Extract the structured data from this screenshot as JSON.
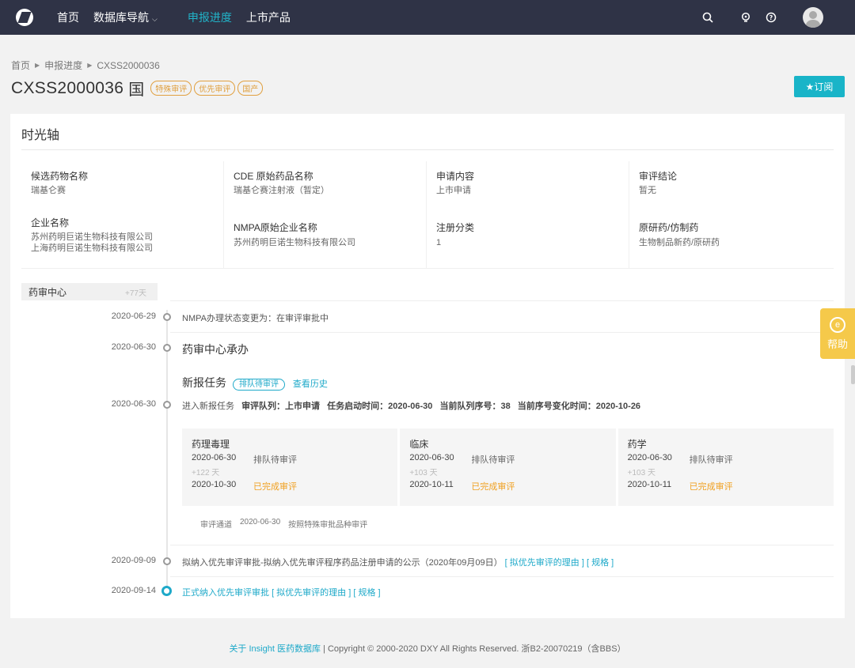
{
  "nav": {
    "items": [
      {
        "label": "首页"
      },
      {
        "label": "数据库导航"
      },
      {
        "label": "申报进度"
      },
      {
        "label": "上市产品"
      }
    ]
  },
  "breadcrumb": {
    "home": "首页",
    "section": "申报进度",
    "current": "CXSS2000036"
  },
  "header": {
    "title": "CXSS2000036",
    "title_suffix": "国",
    "tags": [
      "特殊审评",
      "优先审评",
      "国产"
    ],
    "subscribe_label": "★订阅"
  },
  "card": {
    "title": "时光轴"
  },
  "info": {
    "candidate_label": "候选药物名称",
    "candidate_value": "瑞基仑赛",
    "cde_label": "CDE 原始药品名称",
    "cde_value": "瑞基仑赛注射液（暂定）",
    "apply_label": "申请内容",
    "apply_value": "上市申请",
    "conclusion_label": "审评结论",
    "conclusion_value": "暂无",
    "company_label": "企业名称",
    "company_value_1": "苏州药明巨诺生物科技有限公司",
    "company_value_2": "上海药明巨诺生物科技有限公司",
    "nmpa_label": "NMPA原始企业名称",
    "nmpa_value": "苏州药明巨诺生物科技有限公司",
    "reg_label": "注册分类",
    "reg_value": "1",
    "orig_label": "原研药/仿制药",
    "orig_value": "生物制品新药/原研药"
  },
  "timeline": {
    "center_label": "药审中心",
    "center_days": "+77天",
    "events": [
      {
        "date": "2020-06-29",
        "text": "NMPA办理状态变更为：在审评审批中"
      },
      {
        "date": "2020-06-30",
        "text": "药审中心承办"
      },
      {
        "date": "2020-06-30",
        "text": "进入新报任务"
      }
    ],
    "task_title": "新报任务",
    "task_badge": "排队待审评",
    "task_history": "查看历史",
    "queue_info": "审评队列：上市申请",
    "start_info": "任务启动时间：2020-06-30",
    "seq_info": "当前队列序号：38",
    "seq_change_info": "当前序号变化时间：2020-10-26",
    "reviews": [
      {
        "name": "药理毒理",
        "date1": "2020-06-30",
        "status1": "排队待审评",
        "days": "+122 天",
        "date2": "2020-10-30",
        "status2": "已完成审评"
      },
      {
        "name": "临床",
        "date1": "2020-06-30",
        "status1": "排队待审评",
        "days": "+103 天",
        "date2": "2020-10-11",
        "status2": "已完成审评"
      },
      {
        "name": "药学",
        "date1": "2020-06-30",
        "status1": "排队待审评",
        "days": "+103 天",
        "date2": "2020-10-11",
        "status2": "已完成审评"
      }
    ],
    "channel_label": "审评通道",
    "channel_date": "2020-06-30",
    "channel_text": "按照特殊审批品种审评",
    "priority1_date": "2020-09-09",
    "priority1_text": "拟纳入优先审评审批-拟纳入优先审评程序药品注册申请的公示（2020年09月09日）",
    "priority1_link1": "[ 拟优先审评的理由 ]",
    "priority1_link2": "[ 规格 ]",
    "priority2_date": "2020-09-14",
    "priority2_text": "正式纳入优先审评审批",
    "priority2_link1": "[ 拟优先审评的理由 ]",
    "priority2_link2": "[ 规格 ]"
  },
  "help": {
    "label": "帮助"
  },
  "footer": {
    "link": "关于 Insight 医药数据库",
    "sep": " | ",
    "copyright": "Copyright © 2000-2020 DXY All Rights Reserved. 浙B2-20070219（含BBS）"
  },
  "colors": {
    "nav_bg": "#2f3346",
    "accent": "#19b4c8",
    "warning": "#f0a020",
    "help_bg": "#f5c94a"
  }
}
